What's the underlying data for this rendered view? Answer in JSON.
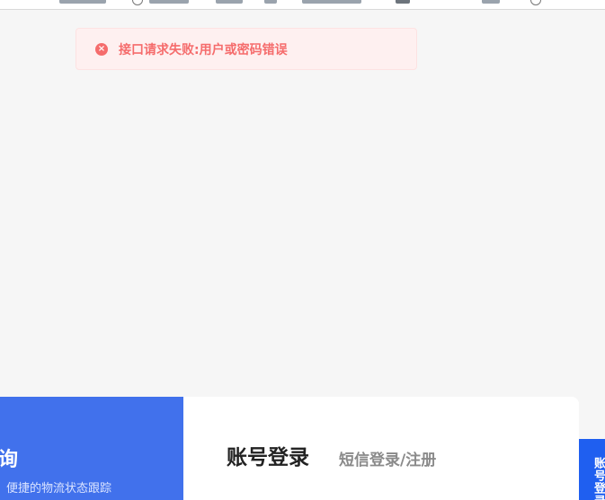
{
  "toast": {
    "icon": "error-circle-icon",
    "message": "接口请求失败:用户或密码错误",
    "color": "#f56c6c",
    "background": "#fef0f0"
  },
  "promo": {
    "title_fragment": "询",
    "subtitle_fragment": "、便捷的物流状态跟踪",
    "background": "#4171ec"
  },
  "login": {
    "tab_account": "账号登录",
    "tab_sms": "短信登录/注册"
  },
  "side_tab": {
    "label": "账号登录",
    "background": "#1f5ff0"
  }
}
